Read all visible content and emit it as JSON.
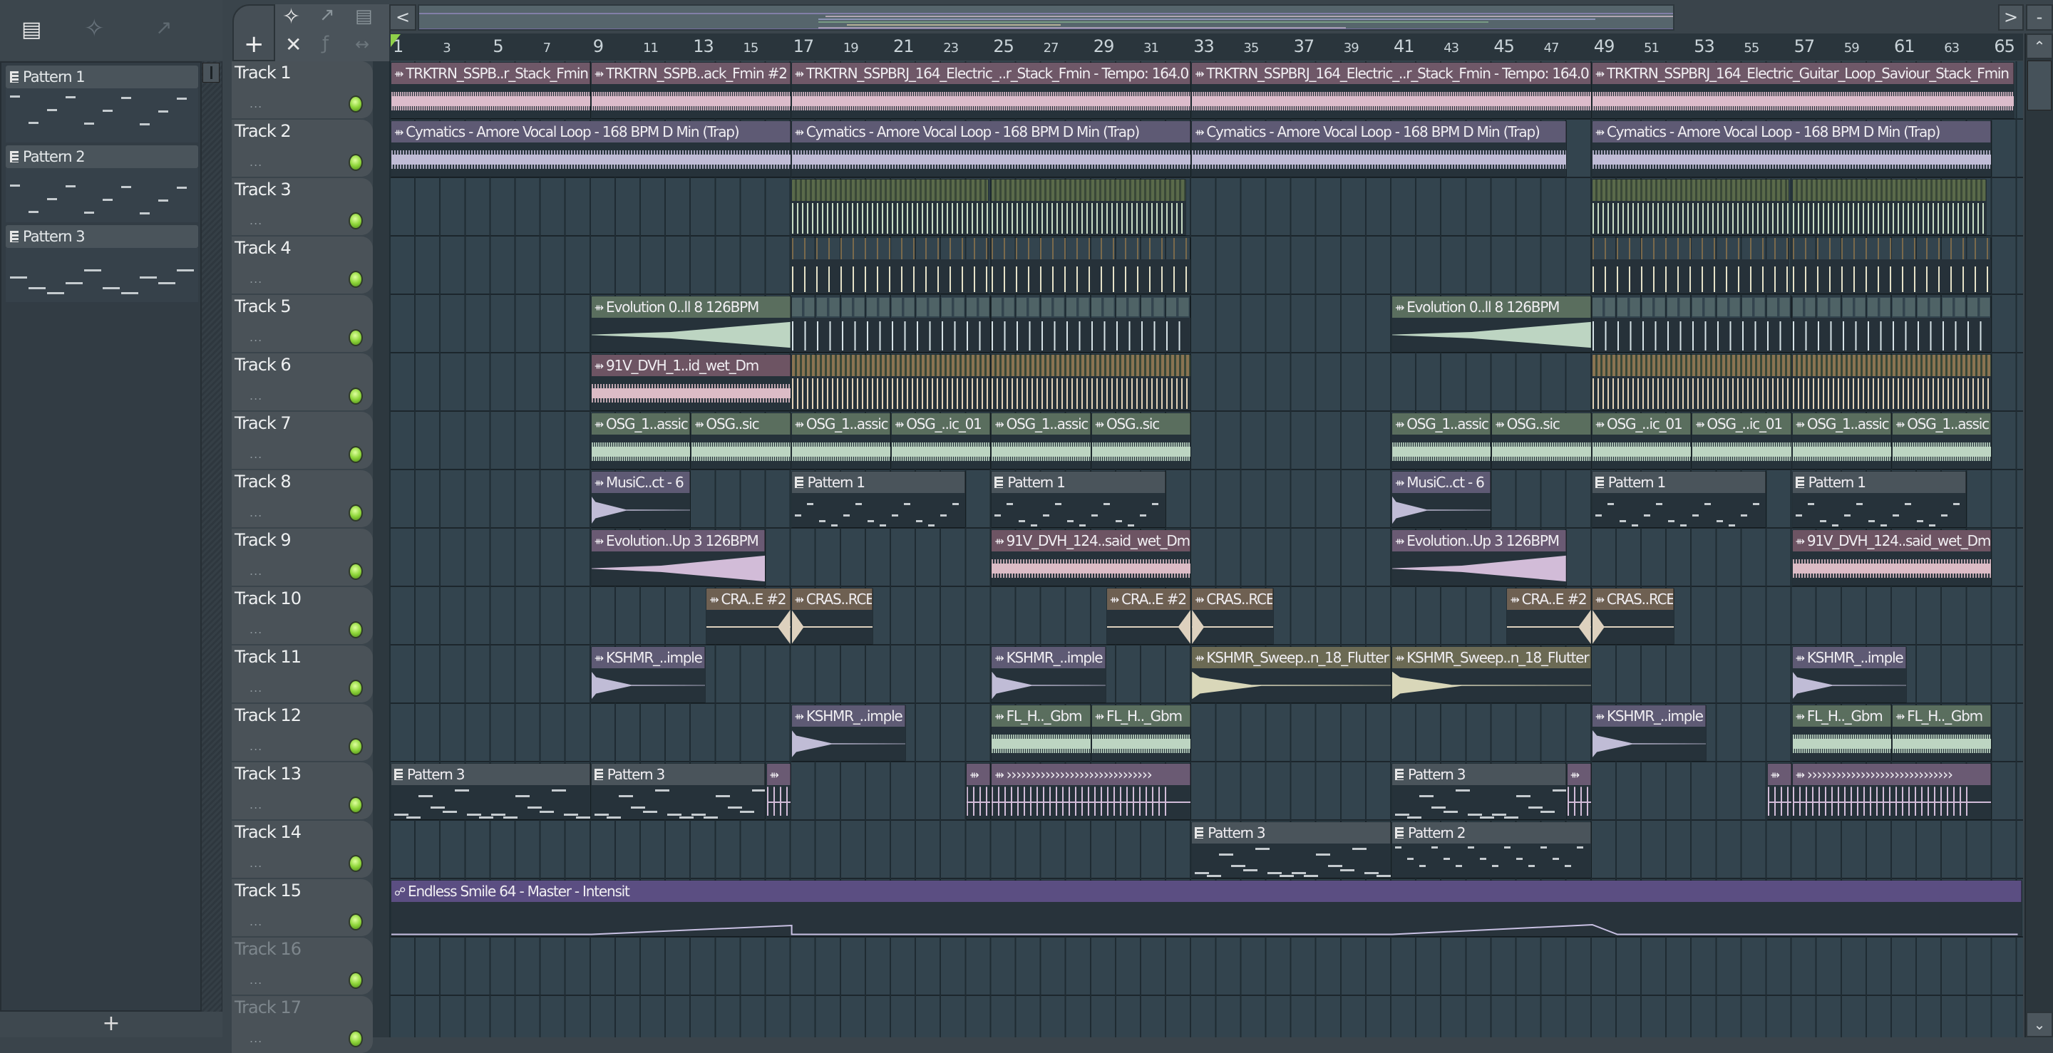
{
  "toolbar": {
    "left_icons": [
      "piano-roll-icon",
      "audio-wave-icon",
      "automation-icon"
    ],
    "add_track_label": "+",
    "tool_icons": [
      "waveform-icon",
      "automation-icon",
      "piano-icon",
      "close-x-icon",
      "slide-icon",
      "stretch-icon"
    ],
    "scroll_left": "<",
    "scroll_right": ">",
    "zoom_btn": "-"
  },
  "pattern_panel": {
    "patterns": [
      {
        "label": "Pattern 1"
      },
      {
        "label": "Pattern 2"
      },
      {
        "label": "Pattern 3"
      }
    ],
    "add_label": "+"
  },
  "ruler": {
    "labels": [
      "1",
      "3",
      "5",
      "7",
      "9",
      "11",
      "13",
      "15",
      "17",
      "19",
      "21",
      "23",
      "25",
      "27",
      "29",
      "31",
      "33",
      "35",
      "37",
      "39",
      "41",
      "43",
      "45",
      "47",
      "49",
      "51",
      "53",
      "55",
      "57",
      "59",
      "61",
      "63",
      "65"
    ]
  },
  "colors": {
    "pink": "#6f5868",
    "lav": "#5e5a74",
    "mauve": "#6a5a73",
    "green": "#5a6e5e",
    "pattern": "#4a545b",
    "brown": "#6e6052",
    "olive": "#6b6a54",
    "auto": "#5b4e82",
    "rose": "#6d5463"
  },
  "tracks": [
    {
      "name": "Track 1",
      "clips": [
        {
          "label": "TRKTRN_SSPB..r_Stack_Fmin",
          "start": 1,
          "len": 8,
          "kind": "pink",
          "wave": "audio"
        },
        {
          "label": "TRKTRN_SSPB..ack_Fmin #2",
          "start": 9,
          "len": 8,
          "kind": "pink",
          "wave": "audio"
        },
        {
          "label": "TRKTRN_SSPBRJ_164_Electric_..r_Stack_Fmin - Tempo: 164.0",
          "start": 17,
          "len": 16,
          "kind": "pink",
          "wave": "audio"
        },
        {
          "label": "TRKTRN_SSPBRJ_164_Electric_..r_Stack_Fmin - Tempo: 164.0",
          "start": 33,
          "len": 16,
          "kind": "pink",
          "wave": "audio"
        },
        {
          "label": "TRKTRN_SSPBRJ_164_Electric_Guitar_Loop_Saviour_Stack_Fmin",
          "start": 49,
          "len": 16.9,
          "kind": "pink",
          "wave": "audio"
        }
      ]
    },
    {
      "name": "Track 2",
      "clips": [
        {
          "label": "Cymatics - Amore Vocal Loop - 168 BPM D Min (Trap)",
          "start": 1,
          "len": 16,
          "kind": "lav",
          "wave": "vocal"
        },
        {
          "label": "Cymatics - Amore Vocal Loop - 168 BPM D Min (Trap)",
          "start": 17,
          "len": 16,
          "kind": "lav",
          "wave": "vocal"
        },
        {
          "label": "Cymatics - Amore Vocal Loop - 168 BPM D Min (Trap)",
          "start": 33,
          "len": 15,
          "kind": "lav",
          "wave": "vocal"
        },
        {
          "label": "Cymatics - Amore Vocal Loop - 168 BPM D Min (Trap)",
          "start": 49,
          "len": 16,
          "kind": "lav",
          "wave": "vocal"
        }
      ]
    },
    {
      "name": "Track 3",
      "clips": [
        {
          "start": 17,
          "len": 7.9,
          "kind": "slice-green",
          "wave": "slices"
        },
        {
          "start": 25,
          "len": 7.8,
          "kind": "slice-green",
          "wave": "slices"
        },
        {
          "start": 49,
          "len": 7.9,
          "kind": "slice-green",
          "wave": "slices"
        },
        {
          "start": 57,
          "len": 7.8,
          "kind": "slice-green",
          "wave": "slices"
        }
      ]
    },
    {
      "name": "Track 4",
      "clips": [
        {
          "start": 17,
          "len": 7.9,
          "kind": "slice-sparse",
          "wave": "sparse"
        },
        {
          "start": 25,
          "len": 8,
          "kind": "slice-sparse",
          "wave": "sparse"
        },
        {
          "start": 49,
          "len": 7.9,
          "kind": "slice-sparse",
          "wave": "sparse"
        },
        {
          "start": 57,
          "len": 8,
          "kind": "slice-sparse",
          "wave": "sparse"
        }
      ]
    },
    {
      "name": "Track 5",
      "clips": [
        {
          "label": "Evolution 0..ll 8 126BPM",
          "start": 9,
          "len": 8,
          "kind": "green",
          "wave": "rise"
        },
        {
          "start": 17,
          "len": 8,
          "kind": "slice-blue",
          "wave": "ticks"
        },
        {
          "start": 25,
          "len": 8,
          "kind": "slice-blue",
          "wave": "ticks"
        },
        {
          "label": "Evolution 0..ll 8 126BPM",
          "start": 41,
          "len": 8,
          "kind": "green",
          "wave": "rise"
        },
        {
          "start": 49,
          "len": 8,
          "kind": "slice-blue",
          "wave": "ticks"
        },
        {
          "start": 57,
          "len": 8,
          "kind": "slice-blue",
          "wave": "ticks"
        }
      ]
    },
    {
      "name": "Track 6",
      "clips": [
        {
          "label": "91V_DVH_1..id_wet_Dm",
          "start": 9,
          "len": 8,
          "kind": "rose",
          "wave": "vocal"
        },
        {
          "start": 17,
          "len": 8,
          "kind": "slice-brown",
          "wave": "slices"
        },
        {
          "start": 25,
          "len": 8,
          "kind": "slice-brown",
          "wave": "slices"
        },
        {
          "start": 49,
          "len": 8,
          "kind": "slice-brown",
          "wave": "slices"
        },
        {
          "start": 57,
          "len": 8,
          "kind": "slice-brown",
          "wave": "slices"
        }
      ]
    },
    {
      "name": "Track 7",
      "clips": [
        {
          "label": "OSG_1..assic",
          "start": 9,
          "len": 4,
          "kind": "green",
          "wave": "audio"
        },
        {
          "label": "OSG..sic",
          "start": 13,
          "len": 4,
          "kind": "green",
          "wave": "audio"
        },
        {
          "label": "OSG_1..assic",
          "start": 17,
          "len": 4,
          "kind": "green",
          "wave": "audio"
        },
        {
          "label": "OSG_..ic_01",
          "start": 21,
          "len": 4,
          "kind": "green",
          "wave": "audio"
        },
        {
          "label": "OSG_1..assic",
          "start": 25,
          "len": 4,
          "kind": "green",
          "wave": "audio"
        },
        {
          "label": "OSG..sic",
          "start": 29,
          "len": 4,
          "kind": "green",
          "wave": "audio"
        },
        {
          "label": "OSG_1..assic",
          "start": 41,
          "len": 4,
          "kind": "green",
          "wave": "audio"
        },
        {
          "label": "OSG..sic",
          "start": 45,
          "len": 4,
          "kind": "green",
          "wave": "audio"
        },
        {
          "label": "OSG_..ic_01",
          "start": 49,
          "len": 4,
          "kind": "green",
          "wave": "audio"
        },
        {
          "label": "OSG_..ic_01",
          "start": 53,
          "len": 4,
          "kind": "green",
          "wave": "audio"
        },
        {
          "label": "OSG_1..assic",
          "start": 57,
          "len": 4,
          "kind": "green",
          "wave": "audio"
        },
        {
          "label": "OSG_1..assic",
          "start": 61,
          "len": 4,
          "kind": "green",
          "wave": "audio"
        }
      ]
    },
    {
      "name": "Track 8",
      "clips": [
        {
          "label": "MusiC..ct - 6",
          "start": 9,
          "len": 4,
          "kind": "lav",
          "wave": "decay"
        },
        {
          "label": "Pattern 1",
          "start": 17,
          "len": 7,
          "kind": "pattern",
          "wave": "notes"
        },
        {
          "label": "Pattern 1",
          "start": 25,
          "len": 7,
          "kind": "pattern",
          "wave": "notes"
        },
        {
          "label": "MusiC..ct - 6",
          "start": 41,
          "len": 4,
          "kind": "lav",
          "wave": "decay"
        },
        {
          "label": "Pattern 1",
          "start": 49,
          "len": 7,
          "kind": "pattern",
          "wave": "notes"
        },
        {
          "label": "Pattern 1",
          "start": 57,
          "len": 7,
          "kind": "pattern",
          "wave": "notes"
        }
      ]
    },
    {
      "name": "Track 9",
      "clips": [
        {
          "label": "Evolution..Up 3 126BPM",
          "start": 9,
          "len": 7,
          "kind": "mauve",
          "wave": "rise"
        },
        {
          "label": "91V_DVH_124..said_wet_Dm",
          "start": 25,
          "len": 8,
          "kind": "rose",
          "wave": "vocal"
        },
        {
          "label": "Evolution..Up 3 126BPM",
          "start": 41,
          "len": 7,
          "kind": "mauve",
          "wave": "rise"
        },
        {
          "label": "91V_DVH_124..said_wet_Dm",
          "start": 57,
          "len": 8,
          "kind": "rose",
          "wave": "vocal"
        }
      ]
    },
    {
      "name": "Track 10",
      "clips": [
        {
          "label": "CRA..E #2",
          "start": 13.6,
          "len": 3.4,
          "kind": "brown",
          "wave": "crash-in"
        },
        {
          "label": "CRAS..RCE",
          "start": 17,
          "len": 3.3,
          "kind": "brown",
          "wave": "crash-out"
        },
        {
          "label": "CRA..E #2",
          "start": 29.6,
          "len": 3.4,
          "kind": "brown",
          "wave": "crash-in"
        },
        {
          "label": "CRAS..RCE",
          "start": 33,
          "len": 3.3,
          "kind": "brown",
          "wave": "crash-out"
        },
        {
          "label": "CRA..E #2",
          "start": 45.6,
          "len": 3.4,
          "kind": "brown",
          "wave": "crash-in"
        },
        {
          "label": "CRAS..RCE",
          "start": 49,
          "len": 3.3,
          "kind": "brown",
          "wave": "crash-out"
        }
      ]
    },
    {
      "name": "Track 11",
      "clips": [
        {
          "label": "KSHMR_..imple",
          "start": 9,
          "len": 4.6,
          "kind": "lav",
          "wave": "decay"
        },
        {
          "label": "KSHMR_..imple",
          "start": 25,
          "len": 4.6,
          "kind": "lav",
          "wave": "decay"
        },
        {
          "label": "KSHMR_Sweep..n_18_Flutter",
          "start": 33,
          "len": 8,
          "kind": "olive",
          "wave": "decay"
        },
        {
          "label": "KSHMR_Sweep..n_18_Flutter",
          "start": 41,
          "len": 8,
          "kind": "olive",
          "wave": "decay"
        },
        {
          "label": "KSHMR_..imple",
          "start": 57,
          "len": 4.6,
          "kind": "lav",
          "wave": "decay"
        }
      ]
    },
    {
      "name": "Track 12",
      "clips": [
        {
          "label": "KSHMR_..imple",
          "start": 17,
          "len": 4.6,
          "kind": "lav",
          "wave": "decay"
        },
        {
          "label": "FL_H.._Gbm",
          "start": 25,
          "len": 4,
          "kind": "green",
          "wave": "audio"
        },
        {
          "label": "FL_H.._Gbm",
          "start": 29,
          "len": 4,
          "kind": "green",
          "wave": "audio"
        },
        {
          "label": "KSHMR_..imple",
          "start": 49,
          "len": 4.6,
          "kind": "lav",
          "wave": "decay"
        },
        {
          "label": "FL_H.._Gbm",
          "start": 57,
          "len": 4,
          "kind": "green",
          "wave": "audio"
        },
        {
          "label": "FL_H.._Gbm",
          "start": 61,
          "len": 4,
          "kind": "green",
          "wave": "audio"
        }
      ]
    },
    {
      "name": "Track 13",
      "clips": [
        {
          "label": "Pattern 3",
          "start": 1,
          "len": 8,
          "kind": "pattern",
          "wave": "bass"
        },
        {
          "label": "Pattern 3",
          "start": 9,
          "len": 7,
          "kind": "pattern",
          "wave": "bass"
        },
        {
          "label": "",
          "start": 16,
          "len": 1,
          "kind": "mauve",
          "wave": "roll"
        },
        {
          "label": "",
          "start": 24,
          "len": 1,
          "kind": "mauve",
          "wave": "roll"
        },
        {
          "label": "››››››››››››››››››››››››››››››",
          "start": 25,
          "len": 8,
          "kind": "mauve",
          "wave": "roll"
        },
        {
          "label": "Pattern 3",
          "start": 41,
          "len": 7,
          "kind": "pattern",
          "wave": "bass"
        },
        {
          "label": "",
          "start": 48,
          "len": 1,
          "kind": "mauve",
          "wave": "roll"
        },
        {
          "label": "",
          "start": 56,
          "len": 1,
          "kind": "mauve",
          "wave": "roll"
        },
        {
          "label": "››››››››››››››››››››››››››››››",
          "start": 57,
          "len": 8,
          "kind": "mauve",
          "wave": "roll"
        }
      ]
    },
    {
      "name": "Track 14",
      "clips": [
        {
          "label": "Pattern 3",
          "start": 33,
          "len": 8,
          "kind": "pattern",
          "wave": "bass"
        },
        {
          "label": "Pattern 2",
          "start": 41,
          "len": 8,
          "kind": "pattern",
          "wave": "drums"
        }
      ]
    },
    {
      "name": "Track 15",
      "clips": [
        {
          "label": "Endless Smile 64 - Master - Intensit",
          "start": 1,
          "len": 65.2,
          "kind": "auto",
          "wave": "automation",
          "points": [
            [
              1,
              0.05
            ],
            [
              9,
              0.05
            ],
            [
              17,
              0.3
            ],
            [
              17,
              0.05
            ],
            [
              41,
              0.05
            ],
            [
              49,
              0.32
            ],
            [
              50,
              0.05
            ],
            [
              66,
              0.05
            ]
          ]
        }
      ]
    },
    {
      "name": "Track 16",
      "dim": true,
      "clips": []
    },
    {
      "name": "Track 17",
      "dim": true,
      "clips": []
    }
  ]
}
